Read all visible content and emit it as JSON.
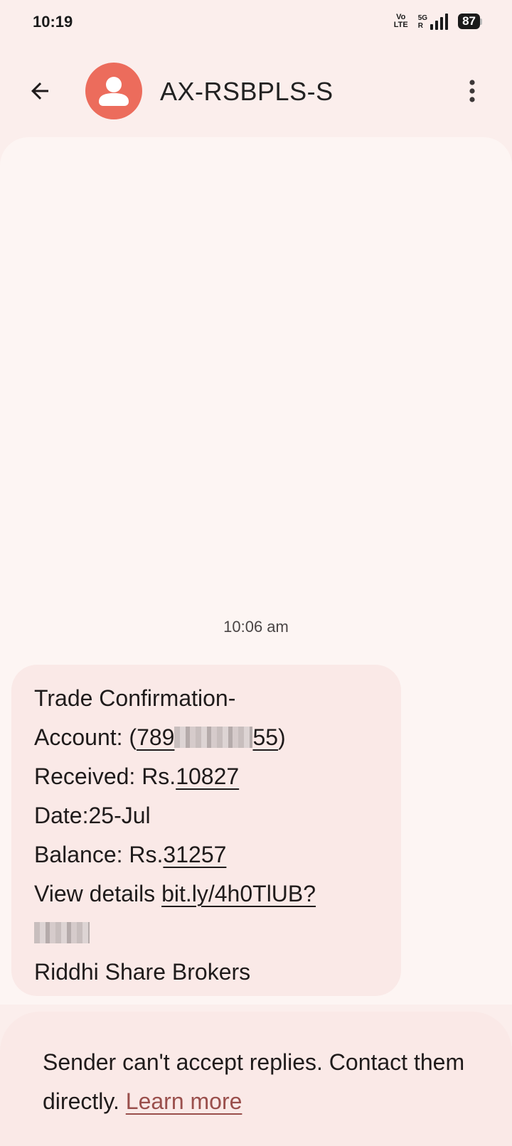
{
  "status_bar": {
    "time": "10:19",
    "volte_top": "Vo",
    "volte_bottom": "LTE",
    "network_type": "5G",
    "roaming": "R",
    "battery": "87"
  },
  "app_bar": {
    "sender": "AX-RSBPLS-S",
    "avatar_color": "#ec6c5c",
    "back_icon": "arrow-left-icon",
    "menu_icon": "more-vert-icon"
  },
  "conversation": {
    "timestamp": "10:06 am",
    "message": {
      "line1": "Trade Confirmation-",
      "account_prefix": "Account: (",
      "account_visible_start": "789",
      "account_visible_end": "55",
      "account_suffix": ")",
      "received_prefix": "Received: Rs.",
      "received_amount": "10827",
      "date_line": "Date:25-Jul",
      "balance_prefix": "Balance: Rs.",
      "balance_amount": "31257",
      "details_prefix": "View details ",
      "details_link": "bit.ly/4h0TlUB?",
      "signature": "Riddhi Share Brokers"
    }
  },
  "footer": {
    "notice": "Sender can't accept replies. Contact them directly.",
    "learn_more": "Learn more",
    "link_color": "#9a4f4c"
  }
}
